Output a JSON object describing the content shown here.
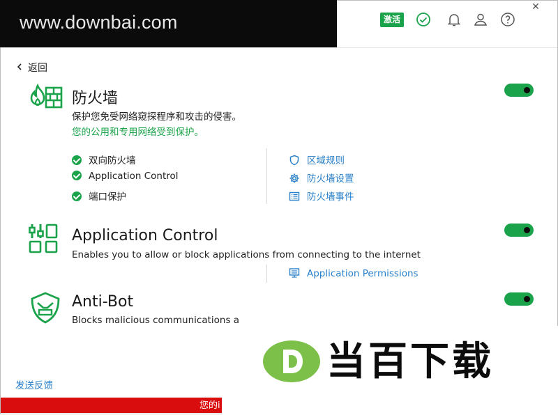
{
  "watermark": {
    "site": "www.downbai.com",
    "logo_text": "当百下载",
    "logo_letter": "D"
  },
  "topbar": {
    "activate_label": "激活",
    "close_glyph": "✕"
  },
  "nav": {
    "back_label": "返回"
  },
  "colors": {
    "accent_green": "#1aa34a",
    "link_blue": "#2a80c9",
    "alert_red": "#d90d0d"
  },
  "sections": {
    "firewall": {
      "icon": "firewall-icon",
      "title": "防火墙",
      "description": "保护您免受网络窥探程序和攻击的侵害。",
      "status": "您的公用和专用网络受到保护。",
      "enabled": true,
      "features": [
        "双向防火墙",
        "Application Control",
        "端口保护"
      ],
      "links": [
        {
          "icon": "shield-icon",
          "label": "区域规则"
        },
        {
          "icon": "gear-icon",
          "label": "防火墙设置"
        },
        {
          "icon": "list-icon",
          "label": "防火墙事件"
        }
      ]
    },
    "app_control": {
      "icon": "app-control-icon",
      "title": "Application Control",
      "description": "Enables you to allow or block applications from connecting to the internet",
      "enabled": true,
      "links": [
        {
          "icon": "monitor-icon",
          "label": "Application Permissions"
        }
      ]
    },
    "antibot": {
      "icon": "anti-bot-icon",
      "title": "Anti-Bot",
      "description": "Blocks malicious communications a",
      "enabled": true
    }
  },
  "footer": {
    "feedback_label": "发送反馈",
    "alert_text": "您的i"
  }
}
